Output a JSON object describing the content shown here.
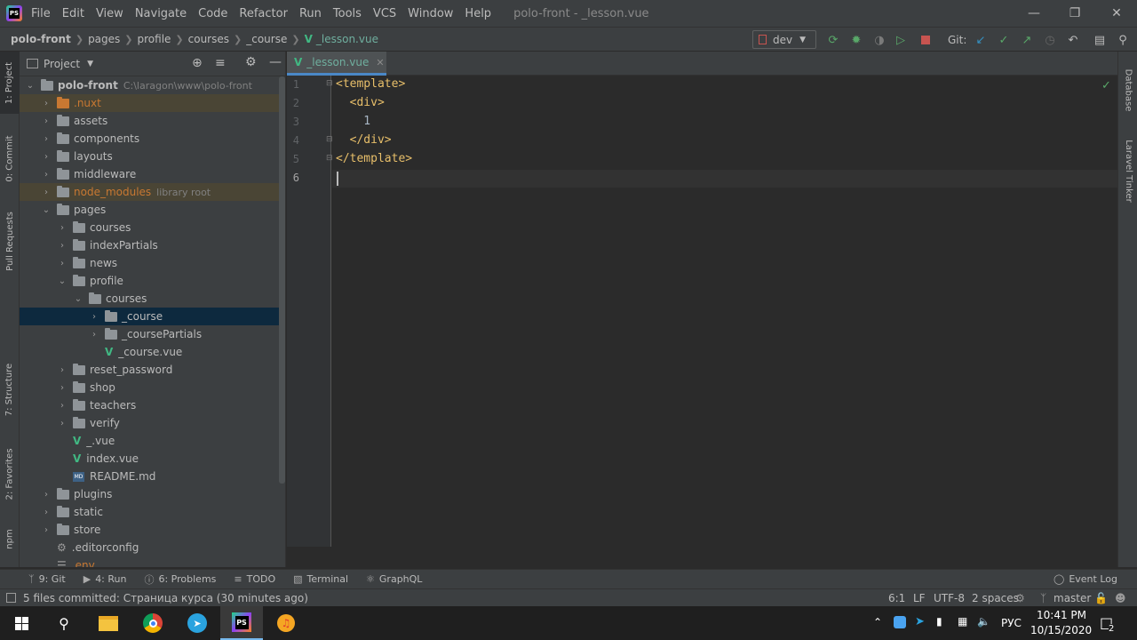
{
  "window": {
    "app_logo_text": "PS",
    "title": "polo-front - _lesson.vue",
    "menu": [
      "File",
      "Edit",
      "View",
      "Navigate",
      "Code",
      "Refactor",
      "Run",
      "Tools",
      "VCS",
      "Window",
      "Help"
    ]
  },
  "navbar": {
    "breadcrumbs": [
      "polo-front",
      "pages",
      "profile",
      "courses",
      "_course",
      "_lesson.vue"
    ],
    "run_config": "dev",
    "git_label": "Git:"
  },
  "left_stripe": {
    "tabs": [
      "1: Project",
      "0: Commit",
      "Pull Requests",
      "7: Structure",
      "2: Favorites",
      "npm"
    ]
  },
  "project_panel": {
    "title": "Project",
    "root": {
      "name": "polo-front",
      "path": "C:\\laragon\\www\\polo-front"
    },
    "nodes": [
      {
        "label": ".nuxt",
        "kind": "folder",
        "state": "excluded"
      },
      {
        "label": "assets",
        "kind": "folder"
      },
      {
        "label": "components",
        "kind": "folder"
      },
      {
        "label": "layouts",
        "kind": "folder"
      },
      {
        "label": "middleware",
        "kind": "folder"
      },
      {
        "label": "node_modules",
        "kind": "folder",
        "state": "excluded",
        "note": "library root"
      },
      {
        "label": "pages",
        "kind": "folder",
        "expanded": true
      },
      {
        "label": "courses",
        "kind": "folder"
      },
      {
        "label": "indexPartials",
        "kind": "folder"
      },
      {
        "label": "news",
        "kind": "folder"
      },
      {
        "label": "profile",
        "kind": "folder",
        "expanded": true
      },
      {
        "label": "courses",
        "kind": "folder",
        "expanded": true
      },
      {
        "label": "_course",
        "kind": "folder",
        "state": "selected"
      },
      {
        "label": "_coursePartials",
        "kind": "folder"
      },
      {
        "label": "_course.vue",
        "kind": "vue"
      },
      {
        "label": "reset_password",
        "kind": "folder"
      },
      {
        "label": "shop",
        "kind": "folder"
      },
      {
        "label": "teachers",
        "kind": "folder"
      },
      {
        "label": "verify",
        "kind": "folder"
      },
      {
        "label": "_.vue",
        "kind": "vue"
      },
      {
        "label": "index.vue",
        "kind": "vue"
      },
      {
        "label": "README.md",
        "kind": "md"
      },
      {
        "label": "plugins",
        "kind": "folder"
      },
      {
        "label": "static",
        "kind": "folder"
      },
      {
        "label": "store",
        "kind": "folder"
      },
      {
        "label": ".editorconfig",
        "kind": "config"
      },
      {
        "label": ".env",
        "kind": "file"
      }
    ]
  },
  "editor": {
    "tab_label": "_lesson.vue",
    "line_numbers": [
      "1",
      "2",
      "3",
      "4",
      "5",
      "6"
    ],
    "lines": [
      {
        "tag": "<template>",
        "text": ""
      },
      {
        "tag": "  <div>",
        "text": ""
      },
      {
        "tag": "",
        "text": "    1"
      },
      {
        "tag": "  </div>",
        "text": ""
      },
      {
        "tag": "</template>",
        "text": ""
      },
      {
        "tag": "",
        "text": ""
      }
    ]
  },
  "right_stripe": {
    "tabs": [
      "Database",
      "Laravel Tinker"
    ]
  },
  "bottom_tools": {
    "items": [
      {
        "key": "9",
        "label": "9: Git",
        "icon": "git-branch-icon"
      },
      {
        "key": "4",
        "label": "4: Run",
        "icon": "run-icon"
      },
      {
        "key": "6",
        "label": "6: Problems",
        "icon": "problems-icon"
      },
      {
        "key": "",
        "label": "TODO",
        "icon": "todo-icon"
      },
      {
        "key": "",
        "label": "Terminal",
        "icon": "terminal-icon"
      },
      {
        "key": "",
        "label": "GraphQL",
        "icon": "graphql-icon"
      }
    ],
    "event_log": "Event Log"
  },
  "statusbar": {
    "message": "5 files committed: Страница курса (30 minutes ago)",
    "caret_pos": "6:1",
    "line_sep": "LF",
    "encoding": "UTF-8",
    "indent": "2 spaces",
    "branch": "master"
  },
  "taskbar": {
    "lang": "РУС",
    "time": "10:41 PM",
    "date": "10/15/2020",
    "notifications": "2"
  },
  "colors": {
    "accent": "#4a88c7",
    "vue": "#41b883",
    "tag": "#e8bf6a",
    "selection": "#0d293e"
  }
}
